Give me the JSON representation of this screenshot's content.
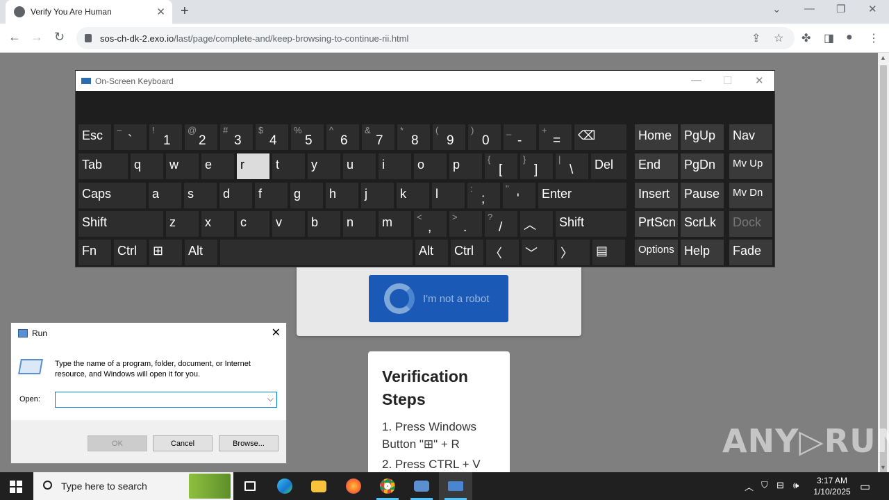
{
  "browser": {
    "tab_title": "Verify You Are Human",
    "url_host": "sos-ch-dk-2.exo.io",
    "url_path": "/last/page/complete-and/keep-browsing-to-continue-rii.html",
    "new_tab": "+",
    "tab_close": "✕"
  },
  "page": {
    "captcha_label": "I'm not a robot",
    "steps_title": "Verification Steps",
    "step1": "1. Press Windows Button \"⊞\" + R",
    "step2": "2. Press CTRL + V",
    "watermark": "ANY▷RUN"
  },
  "osk": {
    "title": "On-Screen Keyboard",
    "rows": [
      [
        {
          "k": "esc",
          "m": "Esc"
        },
        {
          "k": "backtick",
          "t": "~",
          "b": "`"
        },
        {
          "k": "1",
          "t": "!",
          "b": "1"
        },
        {
          "k": "2",
          "t": "@",
          "b": "2"
        },
        {
          "k": "3",
          "t": "#",
          "b": "3"
        },
        {
          "k": "4",
          "t": "$",
          "b": "4"
        },
        {
          "k": "5",
          "t": "%",
          "b": "5"
        },
        {
          "k": "6",
          "t": "^",
          "b": "6"
        },
        {
          "k": "7",
          "t": "&",
          "b": "7"
        },
        {
          "k": "8",
          "t": "*",
          "b": "8"
        },
        {
          "k": "9",
          "t": "(",
          "b": "9"
        },
        {
          "k": "0",
          "t": ")",
          "b": "0"
        },
        {
          "k": "minus",
          "t": "_",
          "b": "-"
        },
        {
          "k": "equals",
          "t": "+",
          "b": "="
        },
        {
          "k": "backspace",
          "m": "⌫"
        },
        {
          "k": "home",
          "m": "Home"
        },
        {
          "k": "pgup",
          "m": "PgUp"
        },
        {
          "k": "nav",
          "m": "Nav"
        }
      ],
      [
        {
          "k": "tab",
          "m": "Tab"
        },
        {
          "k": "q",
          "m": "q"
        },
        {
          "k": "w",
          "m": "w"
        },
        {
          "k": "e",
          "m": "e"
        },
        {
          "k": "r",
          "m": "r"
        },
        {
          "k": "t",
          "m": "t"
        },
        {
          "k": "y",
          "m": "y"
        },
        {
          "k": "u",
          "m": "u"
        },
        {
          "k": "i",
          "m": "i"
        },
        {
          "k": "o",
          "m": "o"
        },
        {
          "k": "p",
          "m": "p"
        },
        {
          "k": "lbracket",
          "t": "{",
          "b": "["
        },
        {
          "k": "rbracket",
          "t": "}",
          "b": "]"
        },
        {
          "k": "backslash",
          "t": "|",
          "b": "\\"
        },
        {
          "k": "del",
          "m": "Del"
        },
        {
          "k": "end",
          "m": "End"
        },
        {
          "k": "pgdn",
          "m": "PgDn"
        },
        {
          "k": "mvup",
          "m": "Mv Up"
        }
      ],
      [
        {
          "k": "caps",
          "m": "Caps"
        },
        {
          "k": "a",
          "m": "a"
        },
        {
          "k": "s",
          "m": "s"
        },
        {
          "k": "d",
          "m": "d"
        },
        {
          "k": "f",
          "m": "f"
        },
        {
          "k": "g",
          "m": "g"
        },
        {
          "k": "h",
          "m": "h"
        },
        {
          "k": "j",
          "m": "j"
        },
        {
          "k": "k",
          "m": "k"
        },
        {
          "k": "l",
          "m": "l"
        },
        {
          "k": "semicolon",
          "t": ":",
          "b": ";"
        },
        {
          "k": "quote",
          "t": "\"",
          "b": "'"
        },
        {
          "k": "enter",
          "m": "Enter"
        },
        {
          "k": "insert",
          "m": "Insert"
        },
        {
          "k": "pause",
          "m": "Pause"
        },
        {
          "k": "mvdn",
          "m": "Mv Dn"
        }
      ],
      [
        {
          "k": "lshift",
          "m": "Shift"
        },
        {
          "k": "z",
          "m": "z"
        },
        {
          "k": "x",
          "m": "x"
        },
        {
          "k": "c",
          "m": "c"
        },
        {
          "k": "v",
          "m": "v"
        },
        {
          "k": "b",
          "m": "b"
        },
        {
          "k": "n",
          "m": "n"
        },
        {
          "k": "m",
          "m": "m"
        },
        {
          "k": "comma",
          "t": "<",
          "b": ","
        },
        {
          "k": "period",
          "t": ">",
          "b": "."
        },
        {
          "k": "slash",
          "t": "?",
          "b": "/"
        },
        {
          "k": "up",
          "m": "︿"
        },
        {
          "k": "rshift",
          "m": "Shift"
        },
        {
          "k": "prtscn",
          "m": "PrtScn"
        },
        {
          "k": "scrlk",
          "m": "ScrLk"
        },
        {
          "k": "dock",
          "m": "Dock"
        }
      ],
      [
        {
          "k": "fn",
          "m": "Fn"
        },
        {
          "k": "lctrl",
          "m": "Ctrl"
        },
        {
          "k": "win",
          "m": "⊞"
        },
        {
          "k": "lalt",
          "m": "Alt"
        },
        {
          "k": "space",
          "m": ""
        },
        {
          "k": "ralt",
          "m": "Alt"
        },
        {
          "k": "rctrl",
          "m": "Ctrl"
        },
        {
          "k": "left",
          "m": "〈"
        },
        {
          "k": "down",
          "m": "﹀"
        },
        {
          "k": "right",
          "m": "〉"
        },
        {
          "k": "menu",
          "m": "▤"
        },
        {
          "k": "options",
          "m": "Options"
        },
        {
          "k": "help",
          "m": "Help"
        },
        {
          "k": "fade",
          "m": "Fade"
        }
      ]
    ]
  },
  "run": {
    "title": "Run",
    "description": "Type the name of a program, folder, document, or Internet resource, and Windows will open it for you.",
    "open_label": "Open:",
    "open_value": "",
    "ok": "OK",
    "cancel": "Cancel",
    "browse": "Browse..."
  },
  "taskbar": {
    "search_placeholder": "Type here to search",
    "time": "3:17 AM",
    "date": "1/10/2025"
  }
}
